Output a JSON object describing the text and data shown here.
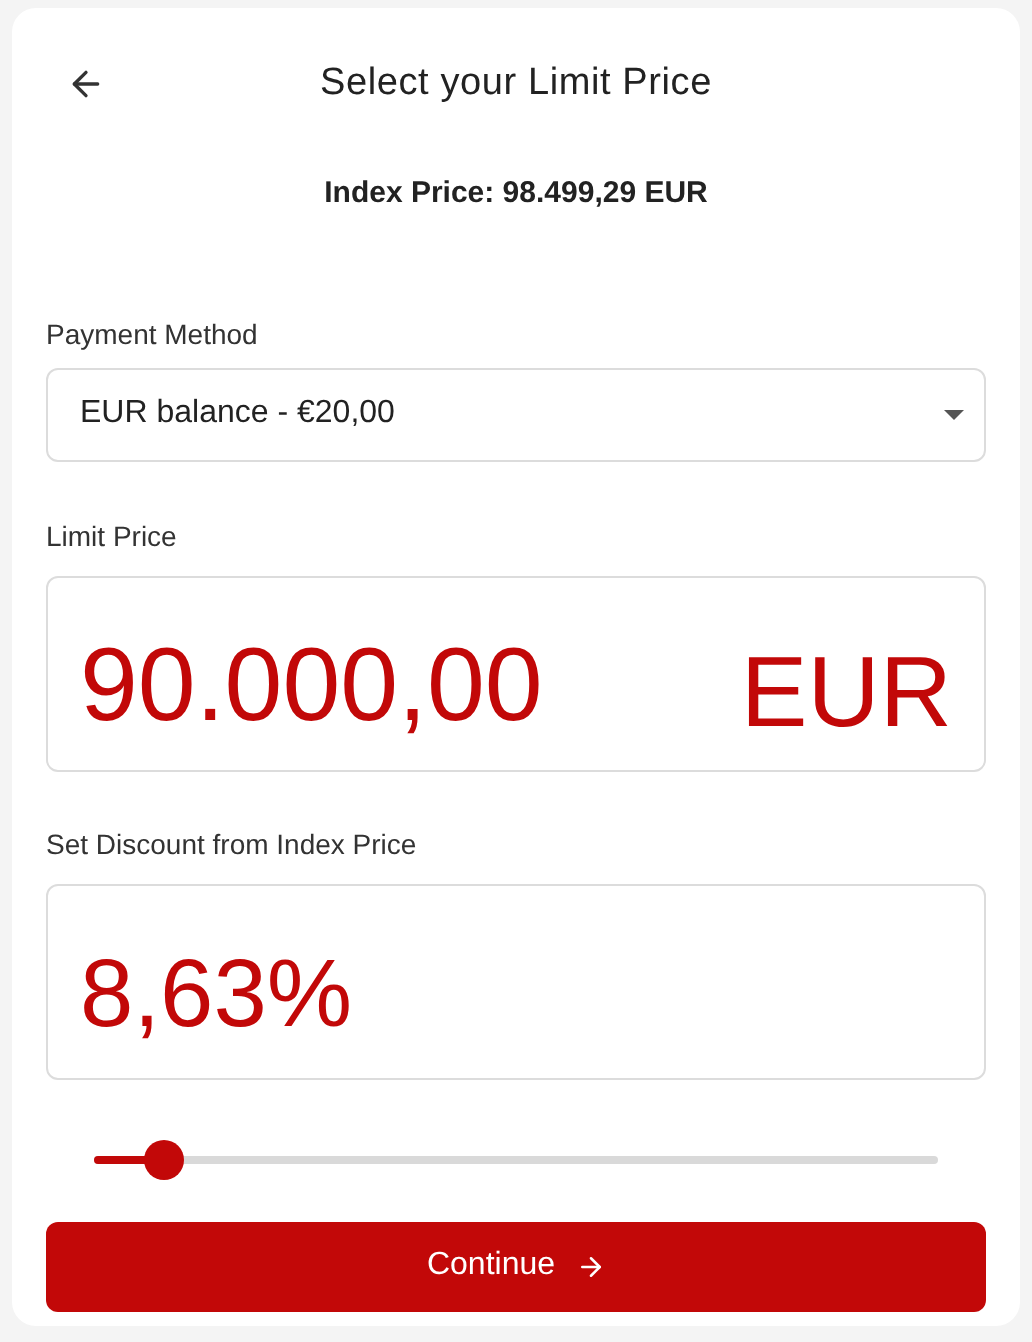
{
  "header": {
    "title": "Select your Limit Price"
  },
  "index_price": "Index Price: 98.499,29 EUR",
  "payment_method": {
    "label": "Payment Method",
    "value": "EUR balance - €20,00"
  },
  "limit_price": {
    "label": "Limit Price",
    "value": "90.000,00",
    "currency": "EUR"
  },
  "discount": {
    "label": "Set Discount from Index Price",
    "value": "8,63%"
  },
  "slider": {
    "level": 0.083
  },
  "continue_button": {
    "label": "Continue"
  }
}
